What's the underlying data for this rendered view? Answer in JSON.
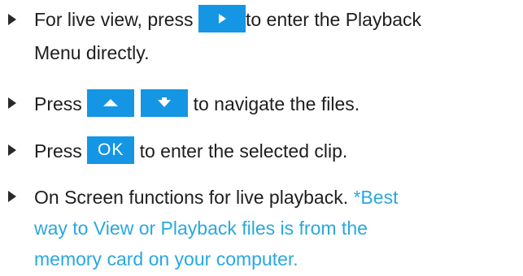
{
  "items": [
    {
      "before": "For live view, press ",
      "key_icon": "play-triangle-icon",
      "after": "to enter the Playback",
      "line2": "Menu directly."
    },
    {
      "before": "Press ",
      "key_icons": [
        "up-arrow-icon",
        "down-arrow-icon"
      ],
      "after": " to navigate the files."
    },
    {
      "before": "Press ",
      "key_label": "OK",
      "after": " to enter the selected clip."
    },
    {
      "text": "On Screen functions for live playback. ",
      "note_line1": "*Best",
      "note_line2": "way to View or Playback files is from the",
      "note_line3": "memory card on your computer."
    }
  ],
  "colors": {
    "key_background": "#1596e4",
    "note_text": "#29a8df",
    "body_text": "#1e1e1e"
  }
}
